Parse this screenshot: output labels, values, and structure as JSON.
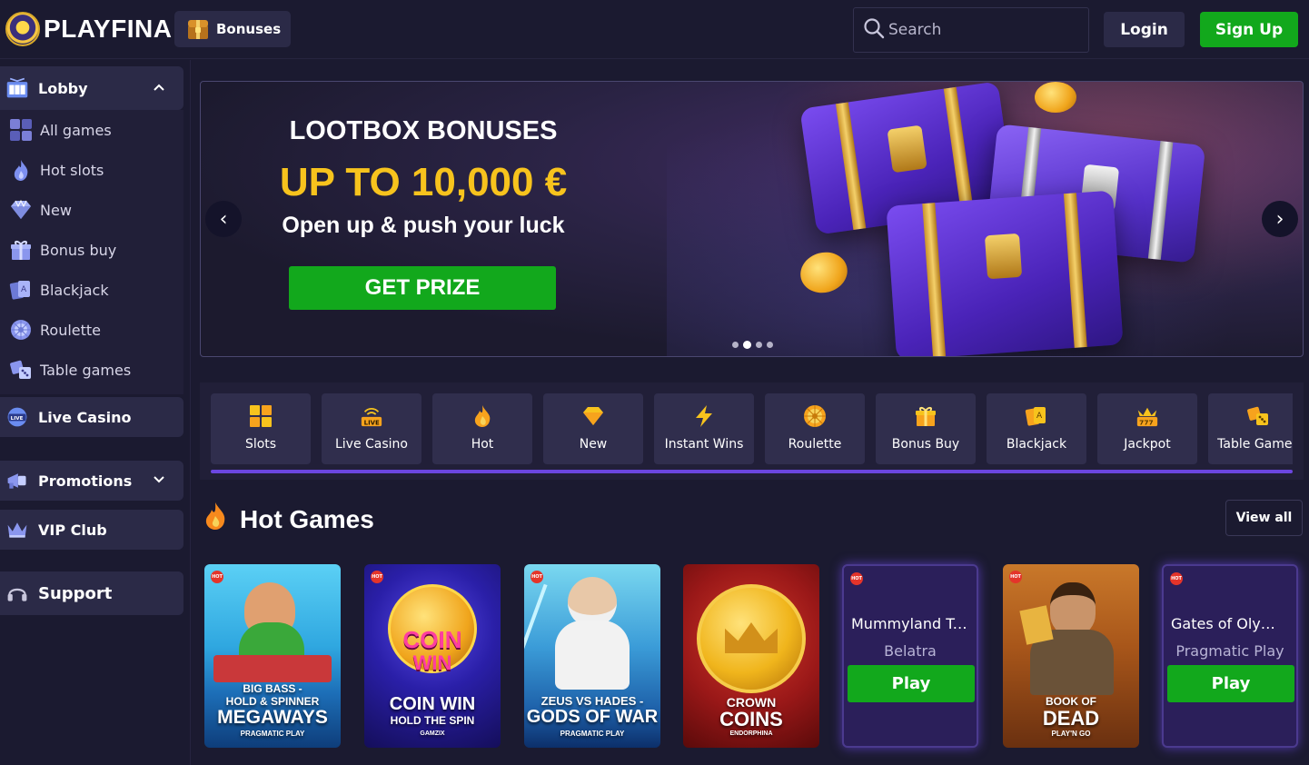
{
  "header": {
    "logo": "PLAYFINA",
    "bonuses_label": "Bonuses",
    "search_placeholder": "Search",
    "login_label": "Login",
    "signup_label": "Sign Up"
  },
  "sidebar": {
    "lobby_label": "Lobby",
    "items": [
      {
        "label": "All games",
        "icon": "grid-icon"
      },
      {
        "label": "Hot slots",
        "icon": "flame-icon"
      },
      {
        "label": "New",
        "icon": "diamond-icon"
      },
      {
        "label": "Bonus buy",
        "icon": "gift-icon"
      },
      {
        "label": "Blackjack",
        "icon": "cards-icon"
      },
      {
        "label": "Roulette",
        "icon": "roulette-icon"
      },
      {
        "label": "Table games",
        "icon": "dice-icon"
      }
    ],
    "live_casino_label": "Live Casino",
    "promotions_label": "Promotions",
    "vip_label": "VIP Club",
    "support_label": "Support"
  },
  "hero": {
    "title": "LOOTBOX BONUSES",
    "amount": "UP TO 10,000 €",
    "subtitle": "Open up & push your luck",
    "cta": "GET PRIZE",
    "prev": "‹",
    "next": "›",
    "slide_count": 4,
    "active_slide": 2
  },
  "categories": [
    {
      "label": "Slots",
      "icon": "slots-icon"
    },
    {
      "label": "Live Casino",
      "icon": "live-icon"
    },
    {
      "label": "Hot",
      "icon": "flame-icon"
    },
    {
      "label": "New",
      "icon": "diamond-icon"
    },
    {
      "label": "Instant Wins",
      "icon": "lightning-icon"
    },
    {
      "label": "Roulette",
      "icon": "roulette-icon"
    },
    {
      "label": "Bonus Buy",
      "icon": "gift-icon"
    },
    {
      "label": "Blackjack",
      "icon": "cards-icon"
    },
    {
      "label": "Jackpot",
      "icon": "jackpot-icon"
    },
    {
      "label": "Table Games",
      "icon": "dice-icon"
    }
  ],
  "hot_games": {
    "title": "Hot Games",
    "view_all": "View all",
    "hot_badge": "HOT",
    "play_label": "Play",
    "games": [
      {
        "line1": "BIG BASS -",
        "line2": "HOLD & SPINNER",
        "line3": "MEGAWAYS",
        "provider": "PRAGMATIC PLAY",
        "hot": true
      },
      {
        "line1": "COIN",
        "line2": "WIN",
        "line3": "COIN WIN",
        "line4": "HOLD THE SPIN",
        "provider": "GAMZIX",
        "hot": true
      },
      {
        "line1": "ZEUS VS HADES -",
        "line2": "GODS OF WAR",
        "provider": "PRAGMATIC PLAY",
        "hot": true
      },
      {
        "line1": "CROWN",
        "line2": "COINS",
        "provider": "ENDORPHINA",
        "hot": false
      },
      {
        "name": "Mummyland Tre...",
        "provider": "Belatra",
        "hot": true,
        "hovered": true
      },
      {
        "line1": "BOOK OF",
        "line2": "DEAD",
        "provider": "PLAY'N GO",
        "hot": true
      },
      {
        "name": "Gates of Olymp...",
        "provider": "Pragmatic Play",
        "hot": true,
        "hovered": true
      }
    ]
  },
  "colors": {
    "background": "#1b1a30",
    "panel": "#2b2a47",
    "green": "#12a81c",
    "gold": "#f7c31d",
    "accent": "#6b46e0"
  }
}
